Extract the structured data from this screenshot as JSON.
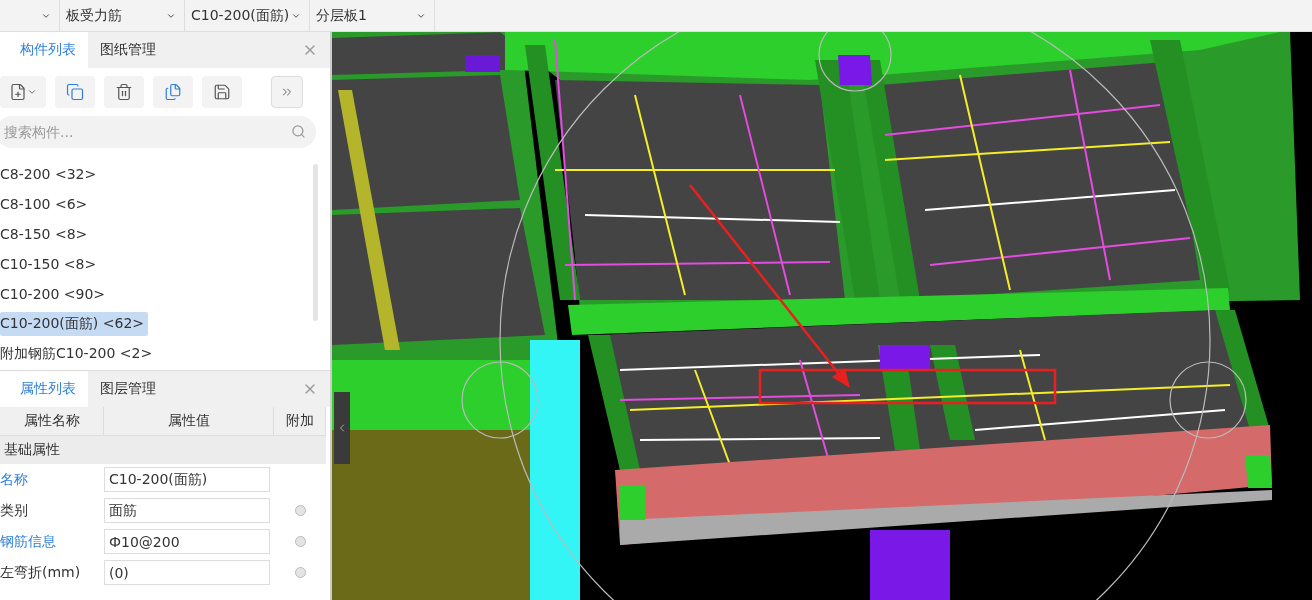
{
  "toolbar": {
    "dropdowns": [
      {
        "kind": "caret"
      },
      {
        "kind": "text",
        "value": "板受力筋"
      },
      {
        "kind": "text",
        "value": "C10-200(面筋)"
      },
      {
        "kind": "text",
        "value": "分层板1"
      }
    ]
  },
  "component_panel": {
    "tabs": [
      {
        "label": "构件列表",
        "selected": true
      },
      {
        "label": "图纸管理",
        "selected": false
      }
    ],
    "search": {
      "placeholder": "搜索构件..."
    },
    "items": [
      {
        "label": "C8-200 <32>",
        "selected": false
      },
      {
        "label": "C8-100 <6>",
        "selected": false
      },
      {
        "label": "C8-150 <8>",
        "selected": false
      },
      {
        "label": "C10-150 <8>",
        "selected": false
      },
      {
        "label": "C10-200 <90>",
        "selected": false
      },
      {
        "label": "C10-200(面筋) <62>",
        "selected": true
      },
      {
        "label": "附加钢筋C10-200 <2>",
        "selected": false
      }
    ]
  },
  "property_panel": {
    "tabs": [
      {
        "label": "属性列表",
        "selected": true
      },
      {
        "label": "图层管理",
        "selected": false
      }
    ],
    "columns": [
      "属性名称",
      "属性值",
      "附加"
    ],
    "group": "基础属性",
    "rows": [
      {
        "name": "名称",
        "value": "C10-200(面筋)",
        "public": true
      },
      {
        "name": "类别",
        "value": "面筋",
        "public": false,
        "attach_checked": false
      },
      {
        "name": "钢筋信息",
        "value": "Ф10@200",
        "public": true,
        "attach_checked": false
      },
      {
        "name": "左弯折(mm)",
        "value": "(0)",
        "public": false,
        "attach_checked": false
      }
    ]
  }
}
